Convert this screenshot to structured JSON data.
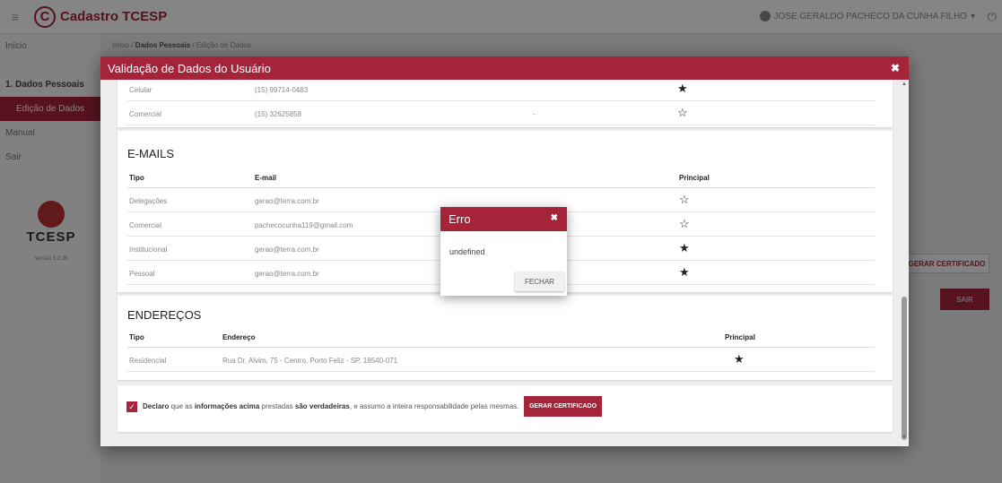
{
  "app": {
    "title": "Cadastro TCESP",
    "logo_letter": "C",
    "user": "JOSE GERALDO PACHECO DA CUNHA FILHO",
    "user_caret": "▾"
  },
  "sidebar": {
    "items": [
      {
        "label": "Início"
      },
      {
        "label": "1. Dados Pessoais"
      },
      {
        "label": "Edição de Dados"
      },
      {
        "label": "Manual"
      },
      {
        "label": "Sair"
      }
    ],
    "logo_text": "TCESP",
    "version": "Versão 1.2.36"
  },
  "breadcrumb": {
    "home": "Início",
    "section": "Dados Pessoais",
    "page": "Edição de Dados"
  },
  "background": {
    "cert_button": "GERAR CERTIFICADO",
    "sair_button": "SAIR"
  },
  "modal": {
    "title": "Validação de Dados do Usuário",
    "close": "✖",
    "phones": {
      "rows": [
        {
          "tipo": "Celular",
          "numero": "(15) 99714-0483",
          "principal": true
        },
        {
          "tipo": "Comercial",
          "numero": "(15) 32625858",
          "extra": "-",
          "principal": false
        }
      ]
    },
    "emails": {
      "title": "E-MAILS",
      "headers": {
        "tipo": "Tipo",
        "email": "E-mail",
        "principal": "Principal"
      },
      "rows": [
        {
          "tipo": "Delegações",
          "email": "gerao@terra.com.br",
          "principal": false
        },
        {
          "tipo": "Comercial",
          "email": "pachecocunha119@gmail.com",
          "principal": false
        },
        {
          "tipo": "Institucional",
          "email": "gerao@terra.com.br",
          "principal": true
        },
        {
          "tipo": "Pessoal",
          "email": "gerao@terra.com.br",
          "principal": true
        }
      ]
    },
    "addresses": {
      "title": "ENDEREÇOS",
      "headers": {
        "tipo": "Tipo",
        "endereco": "Endereço",
        "principal": "Principal"
      },
      "rows": [
        {
          "tipo": "Residencial",
          "endereco": "Rua Dr. Alvim, 75 - Centro, Porto Feliz - SP, 18540-071",
          "principal": true
        }
      ]
    },
    "declaration": {
      "p1": "Declaro",
      "p2": " que as ",
      "p3": "informações acima",
      "p4": " prestadas ",
      "p5": "são verdadeiras",
      "p6": ", e assumo a inteira responsabilidade pelas mesmas.",
      "checked": true,
      "button": "GERAR CERTIFICADO"
    }
  },
  "error_dialog": {
    "title": "Erro",
    "close": "✖",
    "message": "undefined",
    "button": "FECHAR"
  },
  "icons": {
    "star_filled": "★",
    "star_empty": "☆",
    "check": "✓",
    "power": "⏻",
    "menu": "≡"
  },
  "colors": {
    "brand": "#a5243a"
  }
}
